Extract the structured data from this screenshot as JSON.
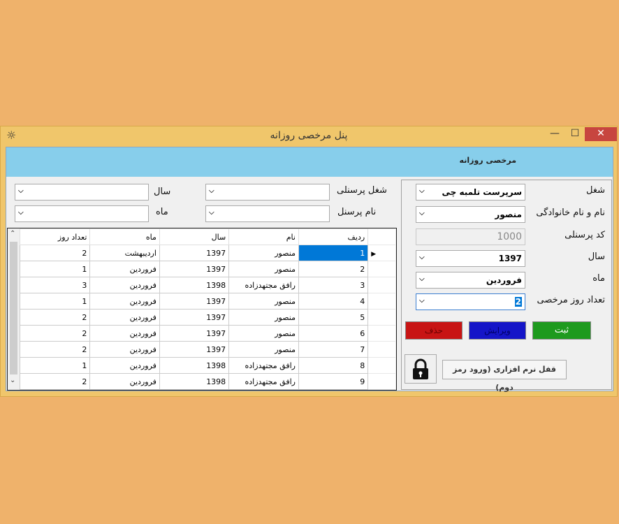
{
  "window": {
    "title": "پنل مرخصی روزانه",
    "min": "—",
    "max": "☐",
    "close": "✕",
    "close_color": "#c7453f"
  },
  "header": {
    "text": "مرخصی روزانه",
    "color": "#87ceeb"
  },
  "filters": {
    "job_label": "شغل پرسنلی",
    "name_label": "نام پرسنل",
    "year_label": "سال",
    "month_label": "ماه",
    "job_value": "",
    "name_value": "",
    "year_value": "",
    "month_value": ""
  },
  "form": {
    "job_label": "شغل",
    "job_value": "سرپرست تلمبه چی",
    "fullname_label": "نام و نام خانوادگی",
    "fullname_value": "منصور",
    "code_label": "کد پرسنلی",
    "code_value": "1000",
    "year_label": "سال",
    "year_value": "1397",
    "month_label": "ماه",
    "month_value": "فروردین",
    "days_label": "تعداد روز مرخصی",
    "days_value": "2"
  },
  "buttons": {
    "save": "ثبت",
    "edit": "ویرایش",
    "delete": "حذف",
    "save_color": "#1e9a1e",
    "edit_color": "#1515c8",
    "delete_color": "#c81414",
    "lock_label": "قفل نرم افزاری (ورود رمز دوم)"
  },
  "grid": {
    "columns": [
      "ردیف",
      "نام",
      "سال",
      "ماه",
      "تعداد روز"
    ],
    "rows": [
      {
        "row": "1",
        "name": "منصور",
        "year": "1397",
        "month": "اردیبهشت",
        "days": "2"
      },
      {
        "row": "2",
        "name": "منصور",
        "year": "1397",
        "month": "فروردین",
        "days": "1"
      },
      {
        "row": "3",
        "name": "رافق مجتهدزاده",
        "year": "1398",
        "month": "فروردین",
        "days": "3"
      },
      {
        "row": "4",
        "name": "منصور",
        "year": "1397",
        "month": "فروردین",
        "days": "1"
      },
      {
        "row": "5",
        "name": "منصور",
        "year": "1397",
        "month": "فروردین",
        "days": "2"
      },
      {
        "row": "6",
        "name": "منصور",
        "year": "1397",
        "month": "فروردین",
        "days": "2"
      },
      {
        "row": "7",
        "name": "منصور",
        "year": "1397",
        "month": "فروردین",
        "days": "2"
      },
      {
        "row": "8",
        "name": "رافق مجتهدزاده",
        "year": "1398",
        "month": "فروردین",
        "days": "1"
      },
      {
        "row": "9",
        "name": "رافق مجتهدزاده",
        "year": "1398",
        "month": "فروردین",
        "days": "2"
      }
    ]
  }
}
